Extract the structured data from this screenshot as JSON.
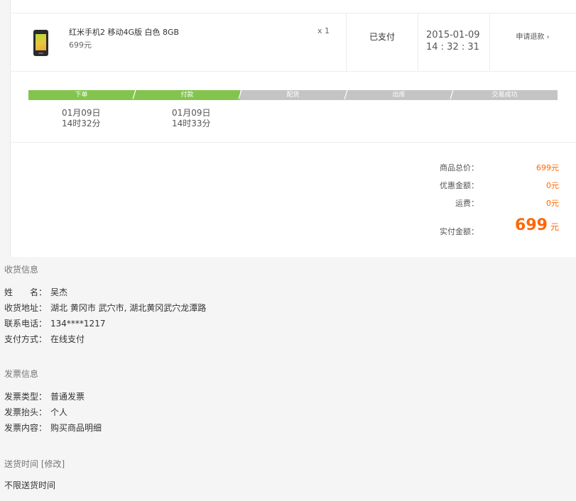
{
  "order": {
    "product": {
      "name": "红米手机2 移动4G版 白色 8GB",
      "price": "699元",
      "quantity": "x 1",
      "image_icon": "phone-thumbnail-icon"
    },
    "status": "已支付",
    "date": "2015-01-09",
    "time": "14 : 32 : 31",
    "refund_label": "申请退款",
    "refund_arrow": "›"
  },
  "progress": {
    "accent_color": "#83c44e",
    "pending_color": "#c4c4c4",
    "steps": [
      {
        "label": "下单",
        "done": true
      },
      {
        "label": "付款",
        "done": true
      },
      {
        "label": "配货",
        "done": false
      },
      {
        "label": "出库",
        "done": false
      },
      {
        "label": "交易成功",
        "done": false
      }
    ],
    "times": [
      {
        "date": "01月09日",
        "time": "14时32分"
      },
      {
        "date": "01月09日",
        "time": "14时33分"
      }
    ]
  },
  "summary": {
    "goods_total_label": "商品总价：",
    "goods_total": "699元",
    "discount_label": "优惠金额：",
    "discount": "0元",
    "shipping_label": "运费：",
    "shipping": "0元",
    "paid_label": "实付金额：",
    "paid_amount": "699",
    "paid_unit": "元",
    "price_color": "#ff6700"
  },
  "shipping_info": {
    "title": "收货信息",
    "name_label": "姓　　名：",
    "name": "吴杰",
    "address_label": "收货地址：",
    "address": "湖北 黄冈市 武穴市, 湖北黄冈武穴龙潭路",
    "phone_label": "联系电话：",
    "phone": "134****1217",
    "payment_label": "支付方式：",
    "payment": "在线支付"
  },
  "invoice_info": {
    "title": "发票信息",
    "type_label": "发票类型：",
    "type": "普通发票",
    "header_label": "发票抬头：",
    "header": "个人",
    "content_label": "发票内容：",
    "content": "购买商品明细"
  },
  "delivery_time": {
    "title": "送货时间",
    "modify_link": "[修改]",
    "value": "不限送货时间"
  }
}
